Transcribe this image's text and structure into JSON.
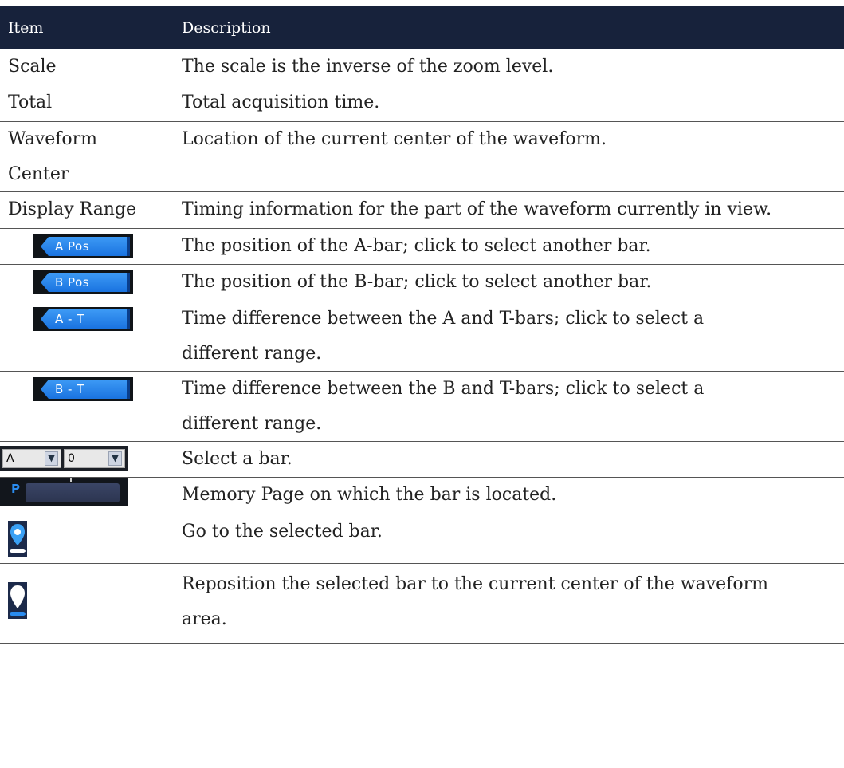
{
  "table": {
    "header": {
      "item": "Item",
      "description": "Description"
    },
    "rows": [
      {
        "item": "Scale",
        "description": "The scale is the inverse of the zoom level."
      },
      {
        "item": "Total",
        "description": "Total acquisition time."
      },
      {
        "item_line1": "Waveform",
        "item_line2": "Center",
        "description": "Location of the current center of the waveform."
      },
      {
        "item": "Display Range",
        "description": "Timing information for the part of the waveform currently in view."
      },
      {
        "icon_label": "A Pos",
        "description": "The position of the A-bar; click to select another bar."
      },
      {
        "icon_label": "B Pos",
        "description": "The position of the B-bar; click to select another bar."
      },
      {
        "icon_label": "A - T",
        "description_line1": "Time difference between the A and T-bars; click to select a",
        "description_line2": "different range."
      },
      {
        "icon_label": "B - T",
        "description_line1": "Time difference between the B and T-bars; click to select a",
        "description_line2": "different range."
      },
      {
        "select_bar": "A",
        "select_page": "0",
        "description": "Select a bar."
      },
      {
        "page_label": "P",
        "description": "Memory Page on which the bar is located."
      },
      {
        "icon": "location-pin-icon",
        "description": "Go to the selected bar."
      },
      {
        "icon": "location-pin-reposition-icon",
        "description_line1": "Reposition the selected bar to the current center of the waveform",
        "description_line2": "area."
      }
    ]
  },
  "colors": {
    "header_bg": "#17223b",
    "tab_blue": "#1a73e0",
    "widget_dark": "#12161c"
  }
}
